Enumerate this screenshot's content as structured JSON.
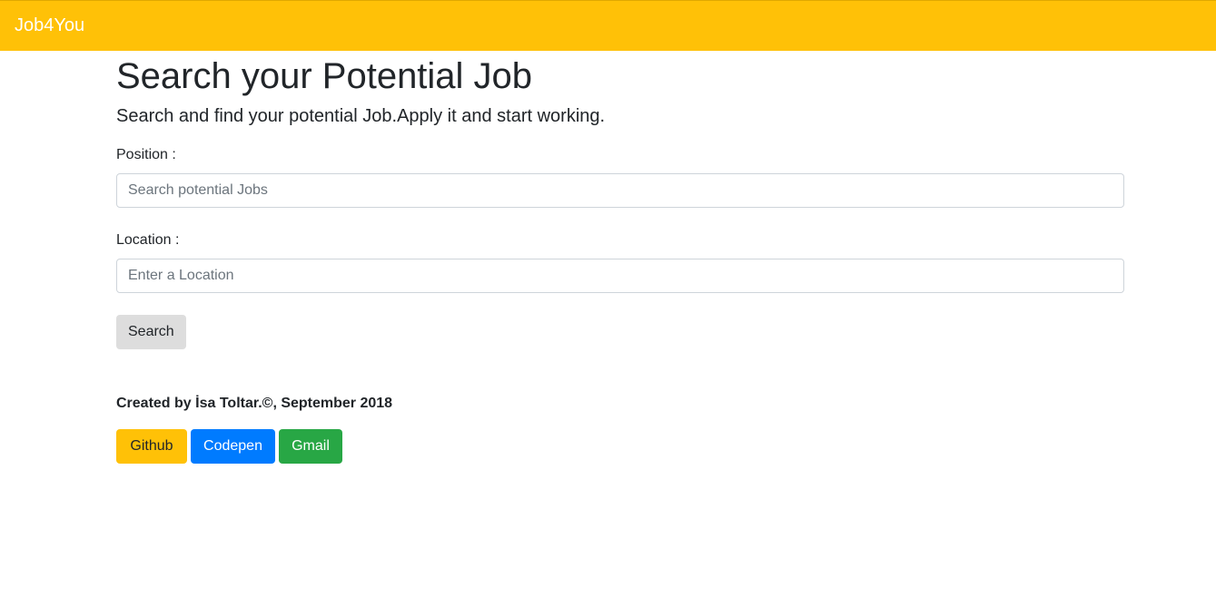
{
  "navbar": {
    "brand": "Job4You",
    "color": "#ffc107"
  },
  "main": {
    "title": "Search your Potential Job",
    "lead": "Search and find your potential Job.Apply it and start working.",
    "position_label": "Position :",
    "position_placeholder": "Search potential Jobs",
    "position_value": "",
    "location_label": "Location :",
    "location_placeholder": "Enter a Location",
    "location_value": "",
    "search_button": "Search"
  },
  "footer": {
    "credit": "Created by İsa Toltar.©, September 2018",
    "links": {
      "github": "Github",
      "codepen": "Codepen",
      "gmail": "Gmail"
    },
    "colors": {
      "github": "#ffc107",
      "codepen": "#007bff",
      "gmail": "#28a745"
    }
  }
}
